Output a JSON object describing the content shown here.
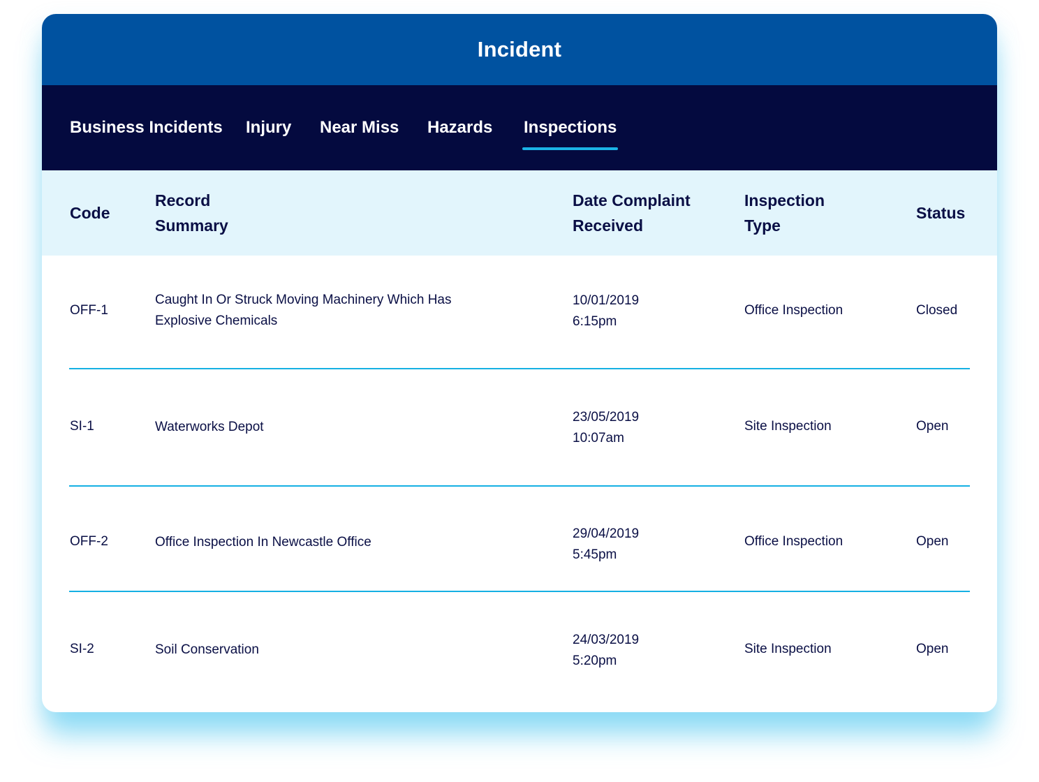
{
  "header": {
    "title": "Incident"
  },
  "nav": {
    "tabs": [
      {
        "label": "Business Incidents",
        "active": false
      },
      {
        "label": "Injury",
        "active": false
      },
      {
        "label": "Near Miss",
        "active": false
      },
      {
        "label": "Hazards",
        "active": false
      },
      {
        "label": "Inspections",
        "active": true
      }
    ]
  },
  "table": {
    "columns": [
      {
        "line1": "Code",
        "line2": ""
      },
      {
        "line1": "Record",
        "line2": "Summary"
      },
      {
        "line1": "Date Complaint",
        "line2": "Received"
      },
      {
        "line1": "Inspection",
        "line2": "Type"
      },
      {
        "line1": "Status",
        "line2": ""
      }
    ],
    "rows": [
      {
        "code": "OFF-1",
        "summary_line1": "Caught In Or Struck Moving Machinery Which Has",
        "summary_line2": "Explosive Chemicals",
        "date": "10/01/2019",
        "time": "6:15pm",
        "type": "Office Inspection",
        "status": "Closed"
      },
      {
        "code": "SI-1",
        "summary_line1": "Waterworks Depot",
        "summary_line2": "",
        "date": "23/05/2019",
        "time": "10:07am",
        "type": "Site Inspection",
        "status": "Open"
      },
      {
        "code": "OFF-2",
        "summary_line1": "Office Inspection In Newcastle Office",
        "summary_line2": "",
        "date": "29/04/2019",
        "time": "5:45pm",
        "type": "Office Inspection",
        "status": "Open"
      },
      {
        "code": "SI-2",
        "summary_line1": "Soil Conservation",
        "summary_line2": "",
        "date": "24/03/2019",
        "time": "5:20pm",
        "type": "Site Inspection",
        "status": "Open"
      }
    ]
  },
  "colors": {
    "title_bar": "#0052A0",
    "nav_bar": "#040A3F",
    "table_header_bg": "#E2F5FC",
    "accent": "#15B0E3",
    "text": "#0A0F45"
  }
}
